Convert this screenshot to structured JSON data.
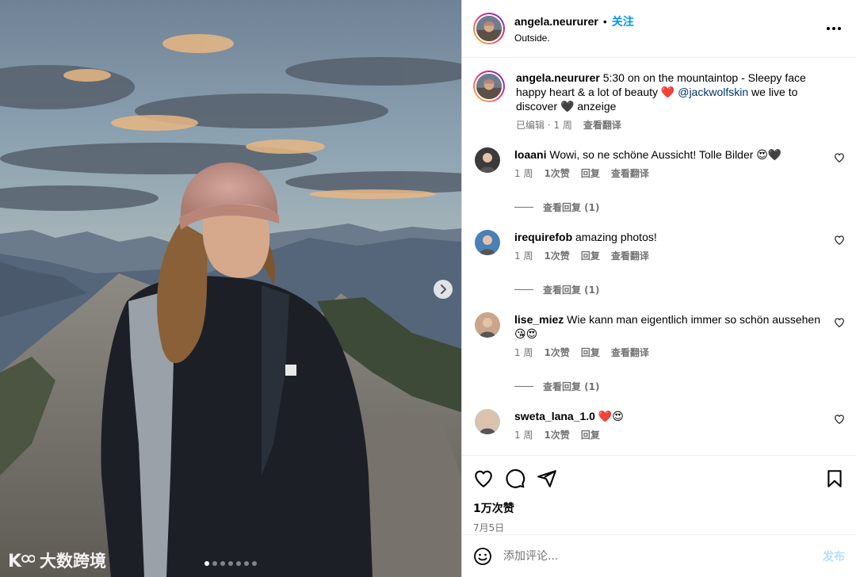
{
  "post": {
    "username": "angela.neururer",
    "follow_label": "关注",
    "separator": "•",
    "location": "Outside.",
    "more_icon": "more-horizontal-icon"
  },
  "caption": {
    "username": "angela.neururer",
    "text_before": " 5:30 on on the mountaintop - Sleepy face happy heart & a lot of beauty ",
    "heart_emoji": "❤️",
    "mention": "@jackwolfskin",
    "text_after": " we live to discover ",
    "black_heart": "🖤",
    "text_end": " anzeige",
    "edited_time": "已编辑 · 1 周",
    "see_translation": "查看翻译"
  },
  "comments": [
    {
      "username": "loaani",
      "text": " Wowi, so ne schöne Aussicht! Tolle Bilder 😍🖤",
      "time": "1 周",
      "likes": "1次赞",
      "reply": "回复",
      "translate": "查看翻译",
      "view_replies": "查看回复 (1)",
      "avatar_color": "#3b3b3b"
    },
    {
      "username": "irequirefob",
      "text": " amazing photos!",
      "time": "1 周",
      "likes": "1次赞",
      "reply": "回复",
      "translate": "查看翻译",
      "view_replies": "查看回复 (1)",
      "avatar_color": "#4a7fb8"
    },
    {
      "username": "lise_miez",
      "text": " Wie kann man eigentlich immer so schön aussehen 😘😍",
      "time": "1 周",
      "likes": "1次赞",
      "reply": "回复",
      "translate": "查看翻译",
      "view_replies": "查看回复 (1)",
      "avatar_color": "#c9a58c"
    },
    {
      "username": "sweta_lana_1.0",
      "text": " ❤️😍",
      "time": "1 周",
      "likes": "1次赞",
      "reply": "回复",
      "translate": "",
      "view_replies": "",
      "avatar_color": "#d7c4b0"
    }
  ],
  "footer": {
    "likes": "1万次赞",
    "date": "7月5日",
    "comment_placeholder": "添加评论...",
    "post_label": "发布"
  },
  "carousel": {
    "total_slides": 7,
    "active_slide": 1
  },
  "watermark": {
    "logo": "K",
    "text": "大数跨境"
  },
  "colors": {
    "follow": "#0095f6",
    "mention": "#00376b",
    "muted": "#737373",
    "post_disabled": "#b2dffc"
  }
}
